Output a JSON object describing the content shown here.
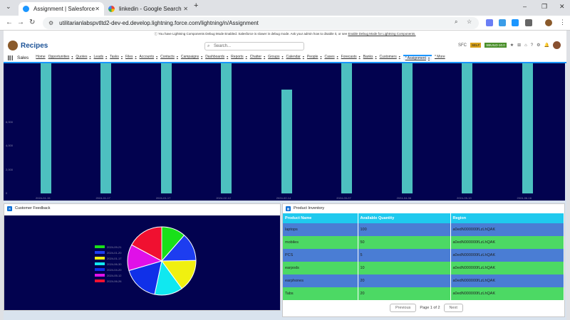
{
  "browser": {
    "tabs": [
      {
        "title": "Assignment | Salesforce",
        "icon": "salesforce-cloud-icon",
        "color": "#1b96ff"
      },
      {
        "title": "linkedin - Google Search",
        "icon": "google-icon",
        "color": "#ea4335"
      }
    ],
    "new_tab": "+",
    "minimize": "–",
    "maximize": "❐",
    "close": "✕",
    "url": "utilitarianlabspvtltd2-dev-ed.develop.lightning.force.com/lightning/n/Assignment",
    "back": "←",
    "forward": "→",
    "reload": "↻"
  },
  "salesforce": {
    "debug_banner_text": "You have Lightning Components Debug Mode Enabled. Salesforce is slower in debug mode. Ask your admin how to disable it, or see",
    "debug_banner_link": "Enable Debug Mode for Lightning Components.",
    "logo": "Recipes",
    "search_placeholder": "Search...",
    "sfc_label": "SFC",
    "badge1": "SELF",
    "badge2": "SBUILD-10.0",
    "app_name": "Sales",
    "nav": [
      "Home",
      "Opportunities",
      "Quotes",
      "Leads",
      "Tasks",
      "Files",
      "Accounts",
      "Contacts",
      "Campaigns",
      "Dashboards",
      "Reports",
      "Chatter",
      "Groups",
      "Calendar",
      "People",
      "Cases",
      "Forecasts",
      "Banks",
      "Customers",
      "* Assignment",
      "* More"
    ]
  },
  "chart_data": {
    "type": "bar",
    "categories": [
      "2024-01-15",
      "2024-01-17",
      "2024-01-17",
      "2024-02-12",
      "2024-02-14",
      "2024-03-07",
      "2024-04-06",
      "2024-05-19",
      "2024-06-16"
    ],
    "values": [
      10000,
      10000,
      10000,
      10000,
      8000,
      10000,
      10000,
      10000,
      10000
    ],
    "ylim": [
      0,
      10000
    ],
    "yticks": [
      "0",
      "2,000",
      "4,000",
      "6,000"
    ],
    "color": "#4dc0c0"
  },
  "feedback": {
    "title": "Customer Feedback",
    "chart_data": {
      "type": "pie",
      "labels": [
        "2024-09-21",
        "2024-01-20",
        "2024-01-17",
        "2024-06-30",
        "2024-04-20",
        "2024-05-12",
        "2024-06-26"
      ],
      "values": [
        12,
        14,
        16,
        14,
        18,
        13,
        18
      ],
      "colors": [
        "#19e019",
        "#1d3df0",
        "#f0f010",
        "#10e8f0",
        "#1030e8",
        "#e010e8",
        "#f01030"
      ]
    }
  },
  "inventory": {
    "title": "Product Inventory",
    "columns": [
      "Product Name",
      "Available Quantity",
      "Region"
    ],
    "rows": [
      [
        "laptops",
        "100",
        "a0edN000000fLzLhQAK"
      ],
      [
        "mobiles",
        "50",
        "a0edN000000fLzLhQAK"
      ],
      [
        "PCS",
        "5",
        "a0edN000000fLzLhQAK"
      ],
      [
        "earpods",
        "10",
        "a0edN000000fLzLhQAK"
      ],
      [
        "earphones",
        "20",
        "a0edN000000fLzLhQAK"
      ],
      [
        "Tabs",
        "20",
        "a0edN000000fLzLhQAK"
      ]
    ],
    "previous": "Previous",
    "page_text": "Page 1 of 2",
    "next": "Next"
  }
}
